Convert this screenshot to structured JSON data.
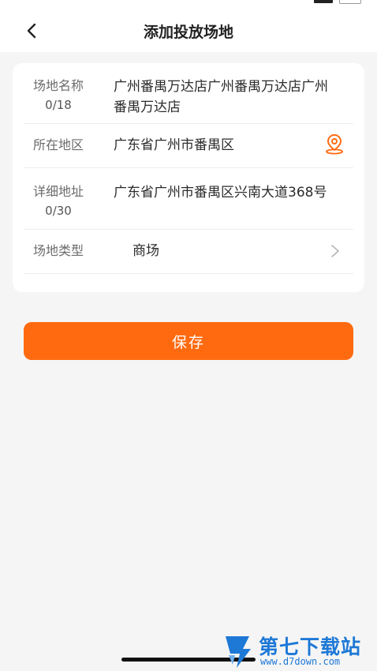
{
  "nav": {
    "title": "添加投放场地"
  },
  "form": {
    "name": {
      "label": "场地名称",
      "count": "0/18",
      "value": "广州番禺万达店广州番禺万达店广州番禺万达店"
    },
    "region": {
      "label": "所在地区",
      "value": "广东省广州市番禺区"
    },
    "address": {
      "label": "详细地址",
      "count": "0/30",
      "value": "广东省广州市番禺区兴南大道368号"
    },
    "type": {
      "label": "场地类型",
      "value": "商场"
    }
  },
  "actions": {
    "save_label": "保存"
  },
  "watermark": {
    "title": "第七下载站",
    "url": "www.d7down.com"
  },
  "colors": {
    "accent": "#ff6a10",
    "location_icon": "#ff6a10",
    "watermark": "#1d78d6"
  }
}
